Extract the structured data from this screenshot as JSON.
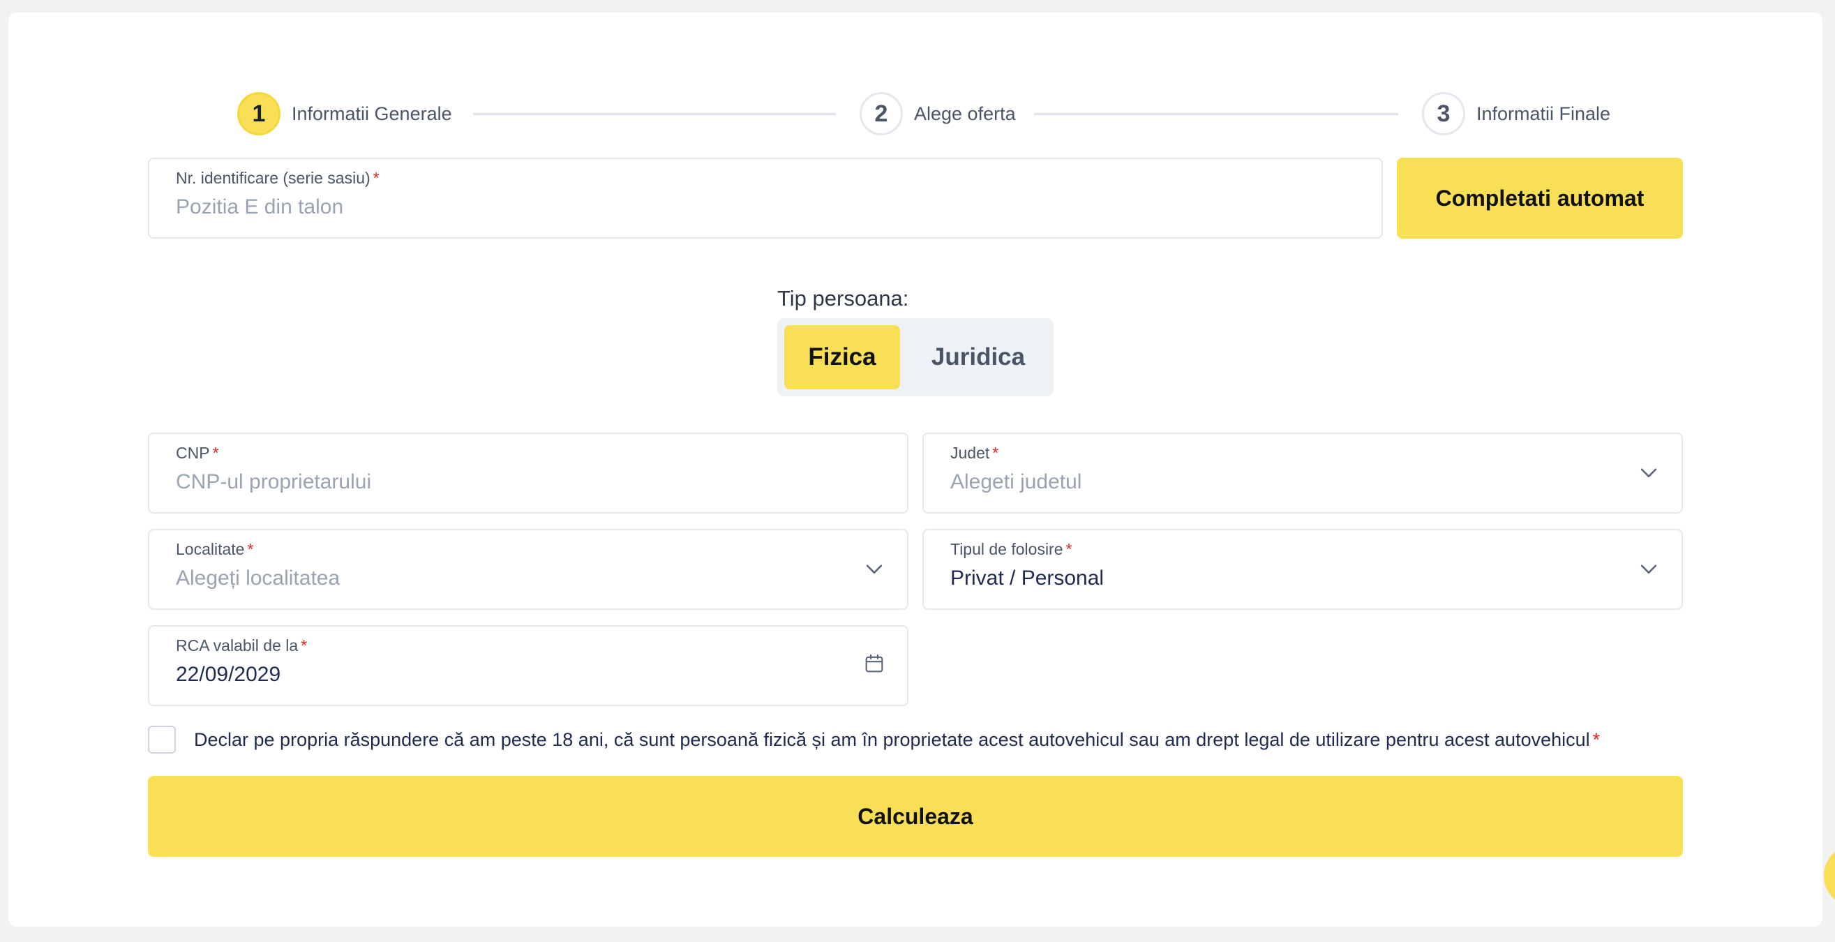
{
  "stepper": {
    "steps": [
      {
        "number": "1",
        "label": "Informatii Generale"
      },
      {
        "number": "2",
        "label": "Alege oferta"
      },
      {
        "number": "3",
        "label": "Informatii Finale"
      }
    ],
    "active_step": 1
  },
  "vin_field": {
    "label": "Nr. identificare (serie sasiu)",
    "required": "*",
    "placeholder": "Pozitia E din talon"
  },
  "autofill_button": {
    "label": "Completati automat"
  },
  "person_type": {
    "label": "Tip persoana:",
    "options": [
      "Fizica",
      "Juridica"
    ],
    "selected": "Fizica"
  },
  "cnp_field": {
    "label": "CNP",
    "required": "*",
    "placeholder": "CNP-ul proprietarului"
  },
  "judet_field": {
    "label": "Judet",
    "required": "*",
    "placeholder": "Alegeti judetul"
  },
  "localitate_field": {
    "label": "Localitate",
    "required": "*",
    "placeholder": "Alegeți localitatea"
  },
  "usage_field": {
    "label": "Tipul de folosire",
    "required": "*",
    "value": "Privat / Personal"
  },
  "rca_field": {
    "label": "RCA valabil de la",
    "required": "*",
    "value": "22/09/2029"
  },
  "declaration": {
    "text": "Declar pe propria răspundere că am peste 18 ani, că sunt persoană fizică și am în proprietate acest autovehicul sau am drept legal de utilizare pentru acest autovehicul",
    "required": "*",
    "checked": false
  },
  "submit_button": {
    "label": "Calculeaza"
  },
  "colors": {
    "accent": "#f8df55",
    "border": "#e3e8ef",
    "text": "#1e2a52",
    "placeholder": "#9aa3b2",
    "required": "#e02424"
  }
}
